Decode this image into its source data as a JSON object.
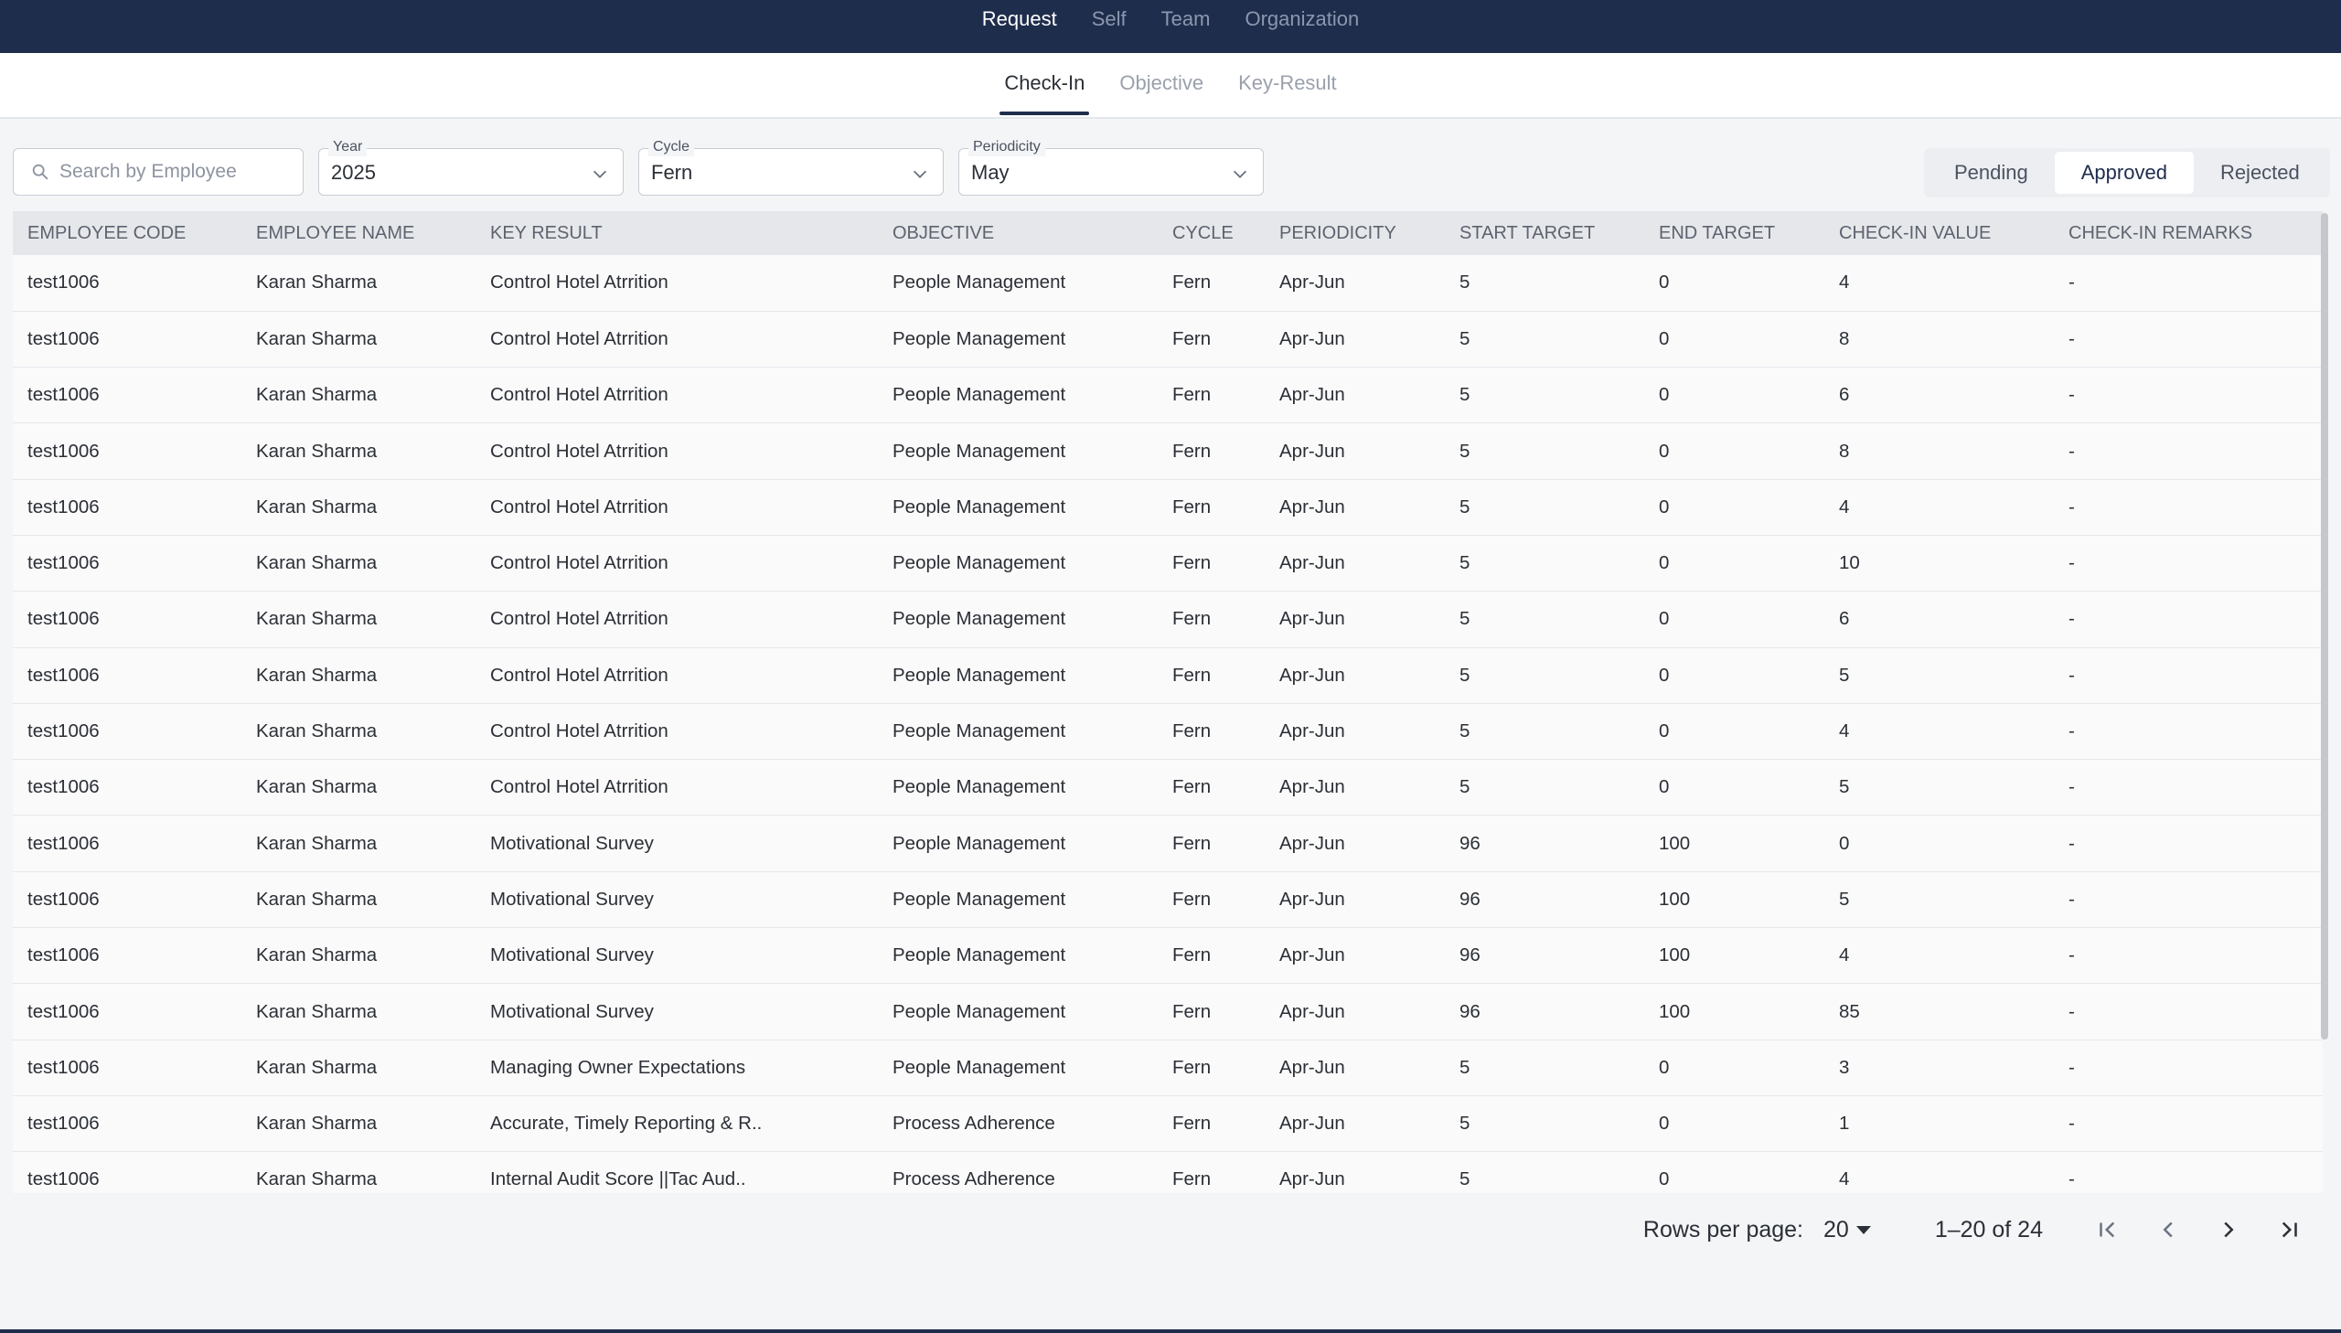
{
  "topnav": {
    "items": [
      "Request",
      "Self",
      "Team",
      "Organization"
    ],
    "active": "Request"
  },
  "subtabs": {
    "items": [
      "Check-In",
      "Objective",
      "Key-Result"
    ],
    "active": "Check-In"
  },
  "filters": {
    "search_placeholder": "Search by Employee",
    "year": {
      "label": "Year",
      "value": "2025"
    },
    "cycle": {
      "label": "Cycle",
      "value": "Fern"
    },
    "periodicity": {
      "label": "Periodicity",
      "value": "May"
    }
  },
  "status_tabs": {
    "items": [
      "Pending",
      "Approved",
      "Rejected"
    ],
    "active": "Approved"
  },
  "table": {
    "columns": [
      "EMPLOYEE CODE",
      "EMPLOYEE NAME",
      "KEY RESULT",
      "OBJECTIVE",
      "CYCLE",
      "PERIODICITY",
      "START TARGET",
      "END TARGET",
      "CHECK-IN VALUE",
      "CHECK-IN REMARKS"
    ],
    "rows": [
      [
        "test1006",
        "Karan Sharma",
        "Control Hotel Atrrition",
        "People Management",
        "Fern",
        "Apr-Jun",
        "5",
        "0",
        "4",
        "-"
      ],
      [
        "test1006",
        "Karan Sharma",
        "Control Hotel Atrrition",
        "People Management",
        "Fern",
        "Apr-Jun",
        "5",
        "0",
        "8",
        "-"
      ],
      [
        "test1006",
        "Karan Sharma",
        "Control Hotel Atrrition",
        "People Management",
        "Fern",
        "Apr-Jun",
        "5",
        "0",
        "6",
        "-"
      ],
      [
        "test1006",
        "Karan Sharma",
        "Control Hotel Atrrition",
        "People Management",
        "Fern",
        "Apr-Jun",
        "5",
        "0",
        "8",
        "-"
      ],
      [
        "test1006",
        "Karan Sharma",
        "Control Hotel Atrrition",
        "People Management",
        "Fern",
        "Apr-Jun",
        "5",
        "0",
        "4",
        "-"
      ],
      [
        "test1006",
        "Karan Sharma",
        "Control Hotel Atrrition",
        "People Management",
        "Fern",
        "Apr-Jun",
        "5",
        "0",
        "10",
        "-"
      ],
      [
        "test1006",
        "Karan Sharma",
        "Control Hotel Atrrition",
        "People Management",
        "Fern",
        "Apr-Jun",
        "5",
        "0",
        "6",
        "-"
      ],
      [
        "test1006",
        "Karan Sharma",
        "Control Hotel Atrrition",
        "People Management",
        "Fern",
        "Apr-Jun",
        "5",
        "0",
        "5",
        "-"
      ],
      [
        "test1006",
        "Karan Sharma",
        "Control Hotel Atrrition",
        "People Management",
        "Fern",
        "Apr-Jun",
        "5",
        "0",
        "4",
        "-"
      ],
      [
        "test1006",
        "Karan Sharma",
        "Control Hotel Atrrition",
        "People Management",
        "Fern",
        "Apr-Jun",
        "5",
        "0",
        "5",
        "-"
      ],
      [
        "test1006",
        "Karan Sharma",
        "Motivational Survey",
        "People Management",
        "Fern",
        "Apr-Jun",
        "96",
        "100",
        "0",
        "-"
      ],
      [
        "test1006",
        "Karan Sharma",
        "Motivational Survey",
        "People Management",
        "Fern",
        "Apr-Jun",
        "96",
        "100",
        "5",
        "-"
      ],
      [
        "test1006",
        "Karan Sharma",
        "Motivational Survey",
        "People Management",
        "Fern",
        "Apr-Jun",
        "96",
        "100",
        "4",
        "-"
      ],
      [
        "test1006",
        "Karan Sharma",
        "Motivational Survey",
        "People Management",
        "Fern",
        "Apr-Jun",
        "96",
        "100",
        "85",
        "-"
      ],
      [
        "test1006",
        "Karan Sharma",
        "Managing Owner Expectations",
        "People Management",
        "Fern",
        "Apr-Jun",
        "5",
        "0",
        "3",
        "-"
      ],
      [
        "test1006",
        "Karan Sharma",
        "Accurate, Timely Reporting & R..",
        "Process Adherence",
        "Fern",
        "Apr-Jun",
        "5",
        "0",
        "1",
        "-"
      ],
      [
        "test1006",
        "Karan Sharma",
        "Internal Audit Score ||Tac Aud..",
        "Process Adherence",
        "Fern",
        "Apr-Jun",
        "5",
        "0",
        "4",
        "-"
      ]
    ]
  },
  "pagination": {
    "rows_per_page_label": "Rows per page:",
    "rows_per_page": "20",
    "range": "1–20 of 24"
  },
  "icons": {
    "search": "search-icon",
    "dropdown": "chevron-down-icon",
    "first": "first-page-icon",
    "prev": "chevron-left-icon",
    "next": "chevron-right-icon",
    "last": "last-page-icon"
  },
  "colors": {
    "nav_bg": "#1f2d4d",
    "header_bg": "#e6e7ea",
    "page_bg": "#f4f5f7"
  }
}
